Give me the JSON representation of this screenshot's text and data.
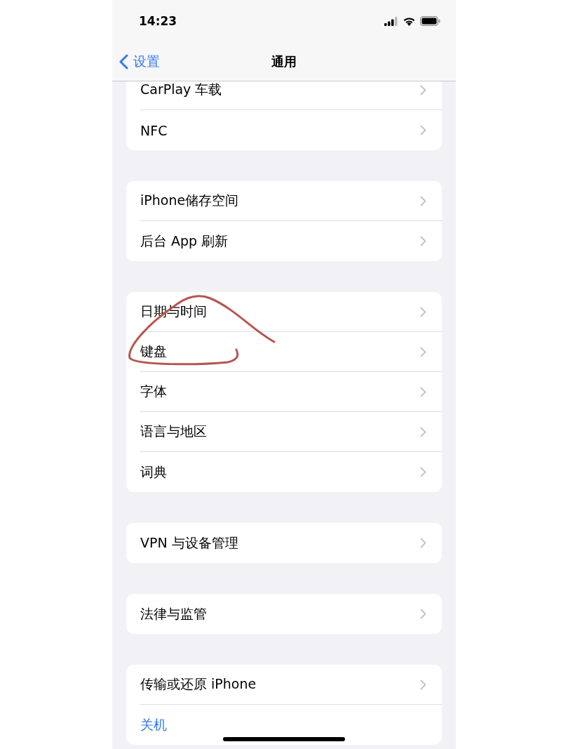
{
  "status_bar": {
    "time": "14:23"
  },
  "nav": {
    "back_label": "设置",
    "title": "通用"
  },
  "groups": [
    {
      "rows": [
        {
          "label": "CarPlay 车载",
          "kind": "link"
        },
        {
          "label": "NFC",
          "kind": "link"
        }
      ]
    },
    {
      "rows": [
        {
          "label": "iPhone储存空间",
          "kind": "link"
        },
        {
          "label": "后台 App 刷新",
          "kind": "link"
        }
      ]
    },
    {
      "rows": [
        {
          "label": "日期与时间",
          "kind": "link"
        },
        {
          "label": "键盘",
          "kind": "link"
        },
        {
          "label": "字体",
          "kind": "link"
        },
        {
          "label": "语言与地区",
          "kind": "link"
        },
        {
          "label": "词典",
          "kind": "link"
        }
      ]
    },
    {
      "rows": [
        {
          "label": "VPN 与设备管理",
          "kind": "link"
        }
      ]
    },
    {
      "rows": [
        {
          "label": "法律与监管",
          "kind": "link"
        }
      ]
    },
    {
      "rows": [
        {
          "label": "传输或还原 iPhone",
          "kind": "link"
        },
        {
          "label": "关机",
          "kind": "action"
        }
      ]
    }
  ]
}
